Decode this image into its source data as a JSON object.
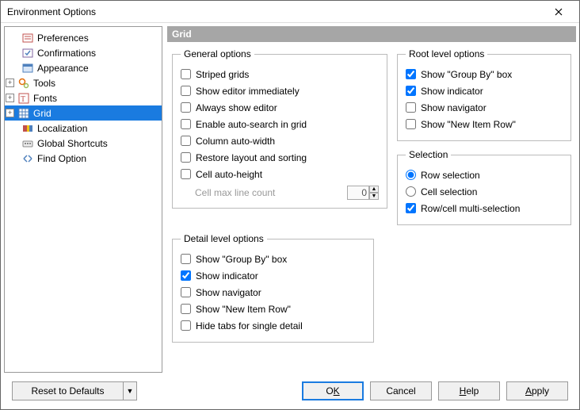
{
  "window": {
    "title": "Environment Options"
  },
  "tree": {
    "items": [
      {
        "label": "Preferences",
        "level": 1,
        "expandable": false
      },
      {
        "label": "Confirmations",
        "level": 1,
        "expandable": false
      },
      {
        "label": "Appearance",
        "level": 1,
        "expandable": false
      },
      {
        "label": "Tools",
        "level": 1,
        "expandable": true
      },
      {
        "label": "Fonts",
        "level": 1,
        "expandable": true
      },
      {
        "label": "Grid",
        "level": 1,
        "expandable": true,
        "selected": true
      },
      {
        "label": "Localization",
        "level": 1,
        "expandable": false
      },
      {
        "label": "Global Shortcuts",
        "level": 1,
        "expandable": false
      },
      {
        "label": "Find Option",
        "level": 1,
        "expandable": false
      }
    ]
  },
  "pane": {
    "title": "Grid",
    "general": {
      "legend": "General options",
      "striped": "Striped grids",
      "showeditor": "Show editor immediately",
      "alwayseditor": "Always show editor",
      "autosearch": "Enable auto-search in grid",
      "colwidth": "Column auto-width",
      "restore": "Restore layout and sorting",
      "cellheight": "Cell auto-height",
      "cellmax_label": "Cell max line count",
      "cellmax_value": "0"
    },
    "root": {
      "legend": "Root level options",
      "groupby": "Show \"Group By\" box",
      "indicator": "Show indicator",
      "navigator": "Show navigator",
      "newitem": "Show \"New Item Row\""
    },
    "selection": {
      "legend": "Selection",
      "row": "Row selection",
      "cell": "Cell selection",
      "multi": "Row/cell multi-selection"
    },
    "detail": {
      "legend": "Detail level options",
      "groupby": "Show \"Group By\" box",
      "indicator": "Show indicator",
      "navigator": "Show navigator",
      "newitem": "Show \"New Item Row\"",
      "hidetabs": "Hide tabs for single detail"
    }
  },
  "footer": {
    "reset": "Reset to Defaults",
    "ok_pre": "O",
    "ok_u": "K",
    "cancel": "Cancel",
    "help_u": "H",
    "help_rest": "elp",
    "apply_u": "A",
    "apply_rest": "pply"
  }
}
